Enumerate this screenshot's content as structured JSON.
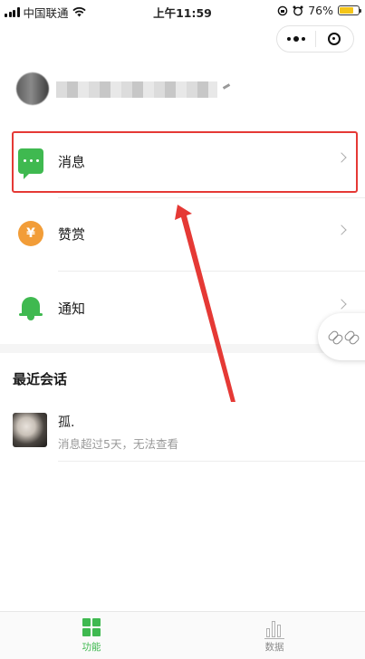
{
  "status_bar": {
    "carrier": "中国联通",
    "time": "上午11:59",
    "battery": "76%",
    "battery_level": 0.76
  },
  "capsule": {
    "more_icon": "more-dots-icon",
    "close_icon": "target-circle-icon"
  },
  "profile": {
    "name_redacted": true
  },
  "menu": [
    {
      "label": "消息",
      "icon": "message-bubble-icon",
      "color": "#3fb950"
    },
    {
      "label": "赞赏",
      "icon": "yen-coin-icon",
      "glyph": "¥",
      "color": "#f29d38"
    },
    {
      "label": "通知",
      "icon": "bell-icon",
      "color": "#3fb950"
    }
  ],
  "recent": {
    "title": "最近会话",
    "conversations": [
      {
        "name": "孤.",
        "subtitle": "消息超过5天，无法查看"
      }
    ]
  },
  "tabbar": {
    "tabs": [
      {
        "label": "功能",
        "active": true,
        "icon": "grid-icon"
      },
      {
        "label": "数据",
        "active": false,
        "icon": "bar-chart-icon"
      }
    ]
  },
  "colors": {
    "accent": "#3fb950",
    "annotation": "#e53935"
  }
}
